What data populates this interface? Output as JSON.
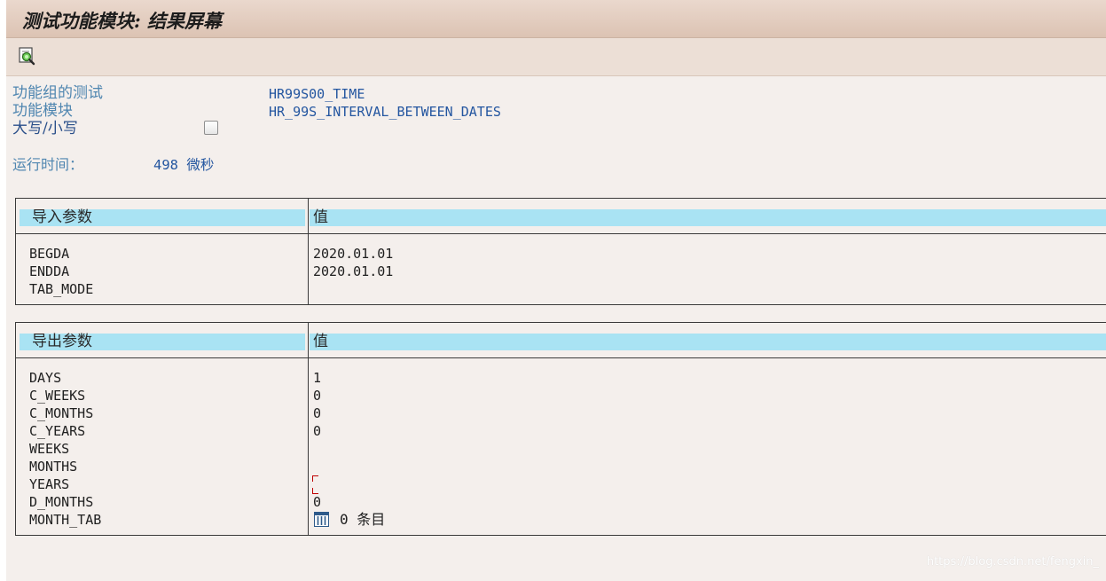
{
  "window": {
    "title": "测试功能模块: 结果屏幕"
  },
  "toolbar": {
    "buttons": [
      {
        "icon": "search-debug-icon"
      }
    ]
  },
  "info": {
    "function_group_label": "功能组的测试",
    "function_group_value": "HR99S00_TIME",
    "function_module_label": "功能模块",
    "function_module_value": "HR_99S_INTERVAL_BETWEEN_DATES",
    "case_label": "大写/小写",
    "case_checked": false,
    "runtime_label": "运行时间：",
    "runtime_value": "498 微秒"
  },
  "import_params": {
    "header_name": "导入参数",
    "header_value": "值",
    "rows": [
      {
        "name": "BEGDA",
        "value": "2020.01.01"
      },
      {
        "name": "ENDDA",
        "value": "2020.01.01"
      },
      {
        "name": "TAB_MODE",
        "value": ""
      }
    ]
  },
  "export_params": {
    "header_name": "导出参数",
    "header_value": "值",
    "rows": [
      {
        "name": "DAYS",
        "value": "1"
      },
      {
        "name": "C_WEEKS",
        "value": "0"
      },
      {
        "name": "C_MONTHS",
        "value": "0"
      },
      {
        "name": "C_YEARS",
        "value": "0"
      },
      {
        "name": "WEEKS",
        "value": ""
      },
      {
        "name": "MONTHS",
        "value": ""
      },
      {
        "name": "YEARS",
        "value": ""
      },
      {
        "name": "D_MONTHS",
        "value": "0"
      },
      {
        "name": "MONTH_TAB",
        "value": "0 条目"
      }
    ]
  },
  "watermark": "https://blog.csdn.net/fengxin_",
  "colors": {
    "title_bar": "#dcc3b3",
    "background": "#f4efec",
    "header_cell": "#a9e3f3",
    "info_label": "#4f86b0",
    "info_value": "#2456a0"
  }
}
